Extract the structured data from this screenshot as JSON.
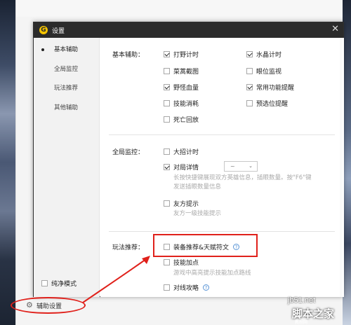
{
  "dialog": {
    "logo": "G",
    "title": "设置",
    "close": "✕"
  },
  "sidebar": {
    "items": [
      {
        "label": "基本辅助",
        "active": true
      },
      {
        "label": "全局监控",
        "active": false
      },
      {
        "label": "玩法推荐",
        "active": false
      },
      {
        "label": "其他辅助",
        "active": false
      }
    ],
    "pure_mode": {
      "label": "纯净模式",
      "checked": false
    }
  },
  "basic": {
    "label": "基本辅助：",
    "options": [
      {
        "label": "打野计时",
        "checked": true
      },
      {
        "label": "水晶计时",
        "checked": true
      },
      {
        "label": "菜蒿截图",
        "checked": false
      },
      {
        "label": "眼位监视",
        "checked": false
      },
      {
        "label": "野怪血量",
        "checked": true
      },
      {
        "label": "常用功能提醒",
        "checked": true
      },
      {
        "label": "技能消耗",
        "checked": false
      },
      {
        "label": "预选位提醒",
        "checked": false
      },
      {
        "label": "死亡回放",
        "checked": false
      }
    ]
  },
  "monitor": {
    "label": "全局监控：",
    "ult_timer": {
      "label": "大招计时",
      "checked": false
    },
    "match_detail": {
      "label": "对局详情",
      "checked": true,
      "dropdown_value": "~"
    },
    "match_hint_1": "长按快捷键展现双方英雄信息，插眼数量。按\"F6\"键",
    "match_hint_2": "发送插眼数量信息",
    "friend_tip": {
      "label": "友方提示",
      "checked": false
    },
    "friend_hint": "友方一级技能提示"
  },
  "play": {
    "label": "玩法推荐：",
    "gear_rec": {
      "label": "装备推荐&天赋符文",
      "checked": false,
      "help": "?"
    },
    "skill_add": {
      "label": "技能加点",
      "checked": false
    },
    "skill_hint": "游戏中高亮提示技能加点路线",
    "lane_guide": {
      "label": "对线攻略",
      "checked": false,
      "help": "?"
    }
  },
  "footer": {
    "assist_settings": "辅助设置",
    "gear_icon": "⚙"
  },
  "watermark": {
    "site": "jb51.net",
    "name": "脚本之家",
    "sub": "教程网"
  },
  "colors": {
    "highlight": "#e0211b",
    "titlebar": "#2b2b2b",
    "logo": "#f5c400"
  }
}
